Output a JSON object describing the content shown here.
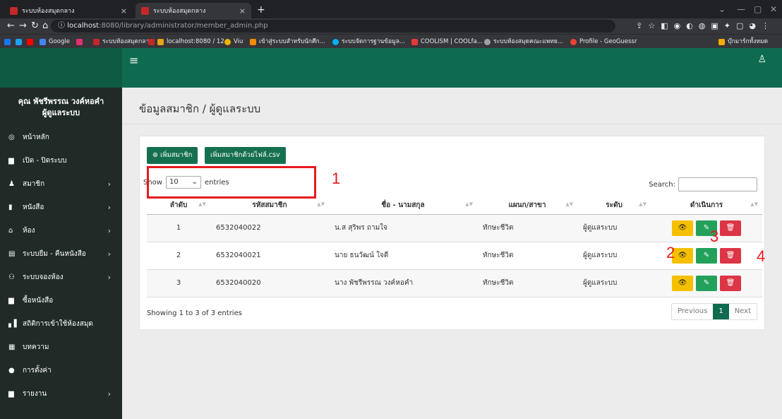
{
  "browser": {
    "tabs": [
      {
        "title": "ระบบห้องสมุดกลาง",
        "close": "×"
      },
      {
        "title": "ระบบห้องสมุดกลาง",
        "close": "×"
      }
    ],
    "new_tab": "+",
    "url_host": "localhost",
    "url_path": ":8080/library/administrator/member_admin.php",
    "bookmarks": [
      {
        "label": "Google",
        "color": "#4285f4"
      },
      {
        "label": "ระบบห้องสมุดกลาง",
        "color": "#c62828"
      },
      {
        "label": "localhost:8080 / 12...",
        "color": "#e8a317"
      },
      {
        "label": "Viu",
        "color": "#f0b400"
      },
      {
        "label": "เข้าสู่ระบบสำหรับนักศึก...",
        "color": "#f28b00"
      },
      {
        "label": "ระบบจัดการฐานข้อมูล...",
        "color": "#00b0f0"
      },
      {
        "label": "COOLISM | COOLfa...",
        "color": "#e53935"
      },
      {
        "label": "ระบบห้องสมุดคณะแพทย...",
        "color": "#9aa0a6"
      },
      {
        "label": "Profile - GeoGuessr",
        "color": "#ea4335"
      },
      {
        "label": "บุ๊กมาร์กทั้งหมด",
        "color": "#f9ab00"
      }
    ]
  },
  "sidebar": {
    "user_name": "คุณ พัชรีพรรณ วงค์หอคำ",
    "user_role": "ผู้ดูแลระบบ",
    "items": [
      {
        "label": "หน้าหลัก",
        "icon": "dashboard-icon",
        "has_submenu": false
      },
      {
        "label": "เปิด - ปิดระบบ",
        "icon": "file-icon",
        "has_submenu": false
      },
      {
        "label": "สมาชิก",
        "icon": "user-icon",
        "has_submenu": true
      },
      {
        "label": "หนังสือ",
        "icon": "book-icon",
        "has_submenu": true
      },
      {
        "label": "ห้อง",
        "icon": "home-icon",
        "has_submenu": true
      },
      {
        "label": "ระบบยืม - คืนหนังสือ",
        "icon": "list-icon",
        "has_submenu": true
      },
      {
        "label": "ระบบจองห้อง",
        "icon": "group-icon",
        "has_submenu": true
      },
      {
        "label": "ซื้อหนังสือ",
        "icon": "file-icon",
        "has_submenu": false
      },
      {
        "label": "สถิติการเข้าใช้ห้องสมุด",
        "icon": "bar-chart-icon",
        "has_submenu": false
      },
      {
        "label": "บทความ",
        "icon": "article-icon",
        "has_submenu": false
      },
      {
        "label": "การตั้งค่า",
        "icon": "info-icon",
        "has_submenu": false
      },
      {
        "label": "รายงาน",
        "icon": "file-icon",
        "has_submenu": true
      }
    ]
  },
  "main": {
    "page_title": "ข้อมูลสมาชิก / ผู้ดูแลระบบ",
    "add_member_label": "⊕ เพิ่มสมาชิก",
    "add_csv_label": "เพิ่มสมาชิกด้วยไฟล์.csv",
    "show_prefix": "Show",
    "show_value": "10",
    "show_suffix": "entries",
    "search_label": "Search:",
    "columns": [
      "ลำดับ",
      "รหัสสมาชิก",
      "ชื่อ - นามสกุล",
      "แผนก/สาขา",
      "ระดับ",
      "ดำเนินการ"
    ],
    "rows": [
      {
        "no": "1",
        "id": "6532040022",
        "name": "น.ส สุริพร ถามใจ",
        "dept": "ทักษะชีวิต",
        "level": "ผู้ดูแลระบบ"
      },
      {
        "no": "2",
        "id": "6532040021",
        "name": "นาย ธนวัฒน์ ใจดี",
        "dept": "ทักษะชีวิต",
        "level": "ผู้ดูแลระบบ"
      },
      {
        "no": "3",
        "id": "6532040020",
        "name": "นาง พัชรีพรรณ วงค์หอคำ",
        "dept": "ทักษะชีวิต",
        "level": "ผู้ดูแลระบบ"
      }
    ],
    "showing_text": "Showing 1 to 3 of 3 entries",
    "pager": {
      "previous": "Previous",
      "current": "1",
      "next": "Next"
    }
  },
  "annotations": {
    "a1": "1",
    "a2": "2",
    "a3": "3",
    "a4": "4",
    "color": "#e8191f"
  }
}
